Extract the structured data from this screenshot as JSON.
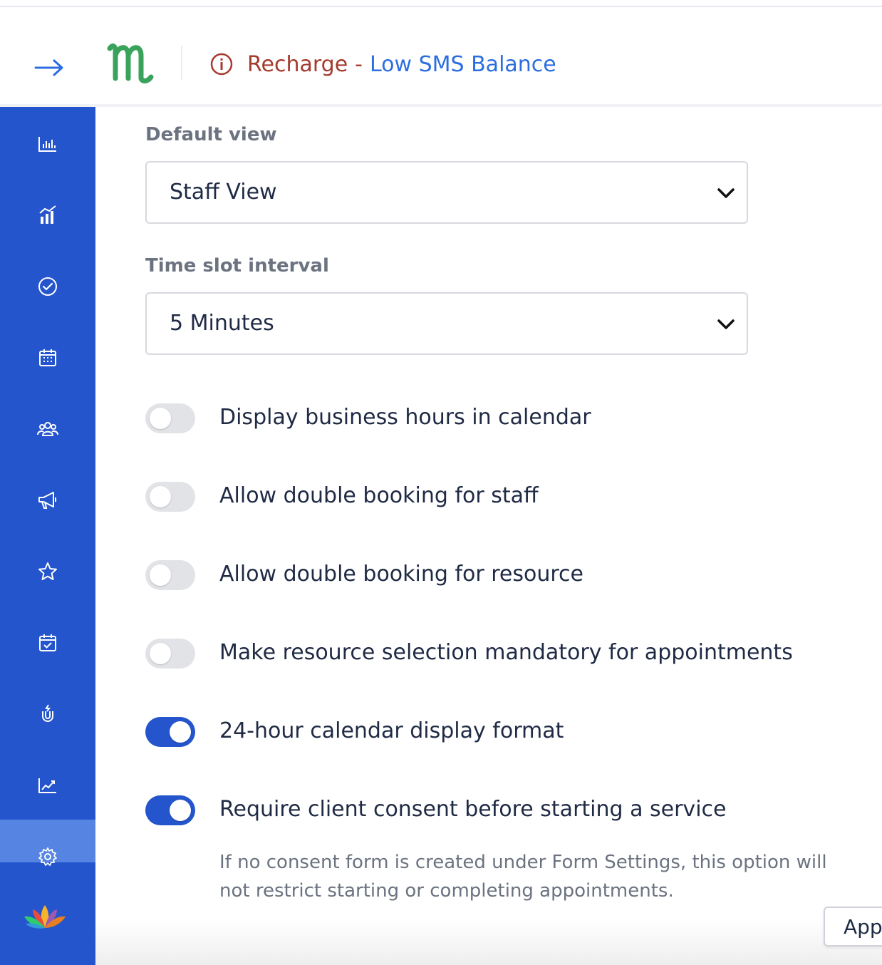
{
  "header": {
    "expand_icon": "arrow-right-icon",
    "logo_icon": "m-logo-icon",
    "alert": {
      "icon": "info-circle-icon",
      "recharge_text": "Recharge",
      "separator": "-",
      "link_text": "Low SMS Balance"
    }
  },
  "sidebar": {
    "items": [
      {
        "icon": "bar-chart-icon"
      },
      {
        "icon": "growth-chart-icon"
      },
      {
        "icon": "check-circle-icon"
      },
      {
        "icon": "calendar-icon"
      },
      {
        "icon": "users-icon"
      },
      {
        "icon": "megaphone-icon"
      },
      {
        "icon": "star-icon"
      },
      {
        "icon": "calendar-check-icon"
      },
      {
        "icon": "magnet-icon"
      },
      {
        "icon": "line-chart-icon"
      },
      {
        "icon": "gear-icon",
        "active": true
      }
    ],
    "brand_icon": "lotus-icon"
  },
  "settings": {
    "default_view": {
      "label": "Default view",
      "value": "Staff View"
    },
    "time_slot": {
      "label": "Time slot interval",
      "value": "5 Minutes"
    },
    "toggles": [
      {
        "label": "Display business hours in calendar",
        "on": false
      },
      {
        "label": "Allow double booking for staff",
        "on": false
      },
      {
        "label": "Allow double booking for resource",
        "on": false
      },
      {
        "label": "Make resource selection mandatory for appointments",
        "on": false
      },
      {
        "label": "24-hour calendar display format",
        "on": true
      },
      {
        "label": "Require client consent before starting a service",
        "on": true
      }
    ],
    "consent_help": "If no consent form is created under Form Settings, this option will not restrict starting or completing appointments."
  },
  "app_button": {
    "label": "App"
  },
  "colors": {
    "sidebar": "#2555cc",
    "sidebar_active": "#5584e2",
    "accent": "#2555cc",
    "alert_red": "#a53a2e",
    "link_blue": "#2c6ee0",
    "logo_green": "#3aa35b"
  }
}
